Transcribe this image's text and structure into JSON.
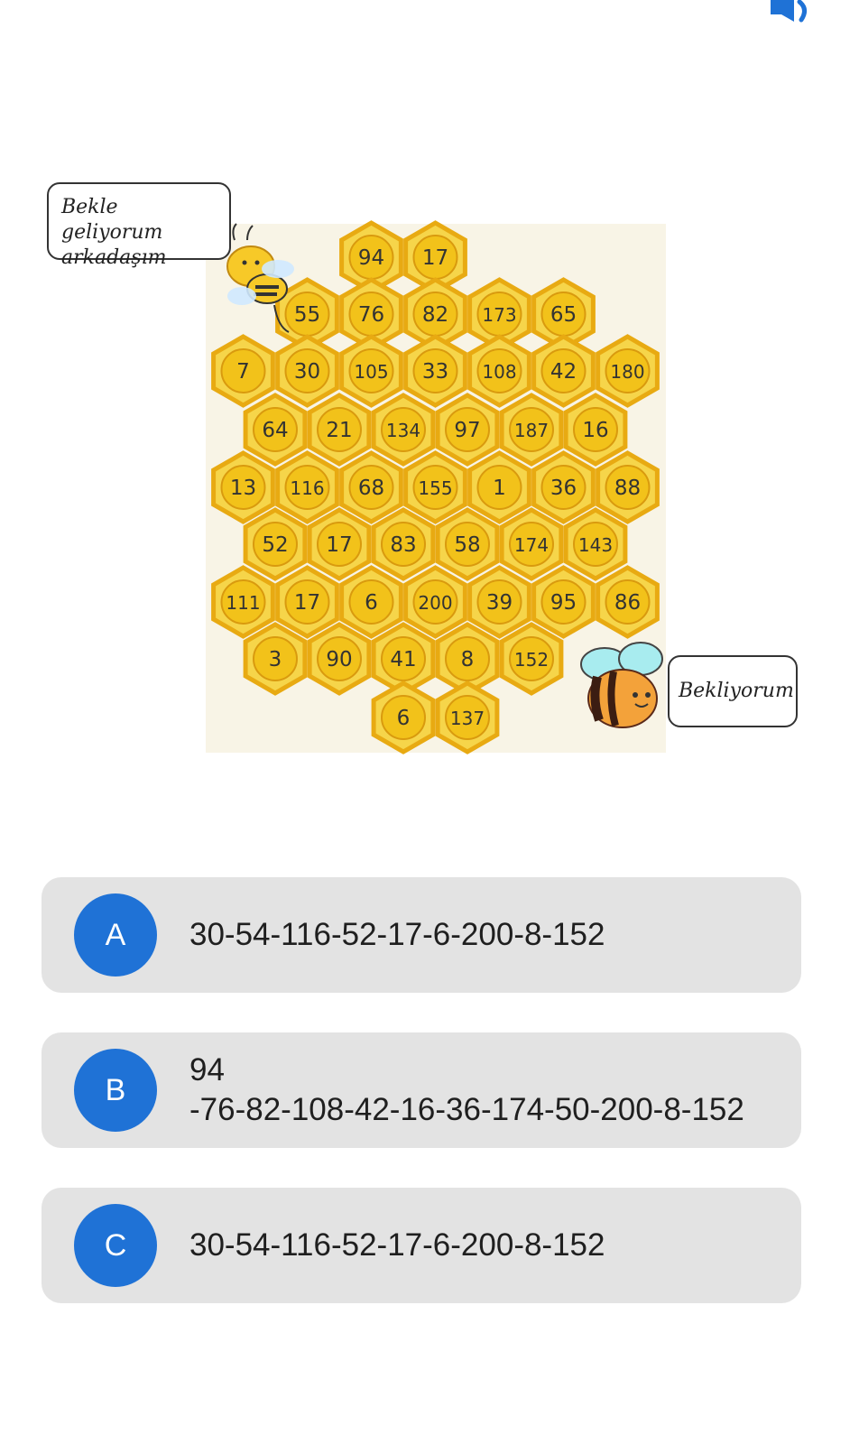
{
  "header": {
    "speaker_icon": "speaker-icon",
    "accent_color": "#1f72d6"
  },
  "puzzle": {
    "bubble_left": "Bekle geliyorum\narkadaşım",
    "bubble_right": "Bekliyorum",
    "rows": [
      [
        "94",
        "17"
      ],
      [
        "55",
        "76",
        "82",
        "173",
        "65"
      ],
      [
        "7",
        "30",
        "105",
        "33",
        "108",
        "42",
        "180"
      ],
      [
        "64",
        "21",
        "134",
        "97",
        "187",
        "16"
      ],
      [
        "13",
        "116",
        "68",
        "155",
        "1",
        "36",
        "88"
      ],
      [
        "52",
        "17",
        "83",
        "58",
        "174",
        "143"
      ],
      [
        "111",
        "17",
        "6",
        "200",
        "39",
        "95",
        "86"
      ],
      [
        "3",
        "90",
        "41",
        "8",
        "152"
      ],
      [
        "6",
        "137"
      ]
    ],
    "honey_color": "#f2c21a"
  },
  "options": [
    {
      "letter": "A",
      "text": "30-54-116-52-17-6-200-8-152"
    },
    {
      "letter": "B",
      "text": "94\n-76-82-108-42-16-36-174-50-200-8-152"
    },
    {
      "letter": "C",
      "text": "30-54-116-52-17-6-200-8-152"
    }
  ]
}
